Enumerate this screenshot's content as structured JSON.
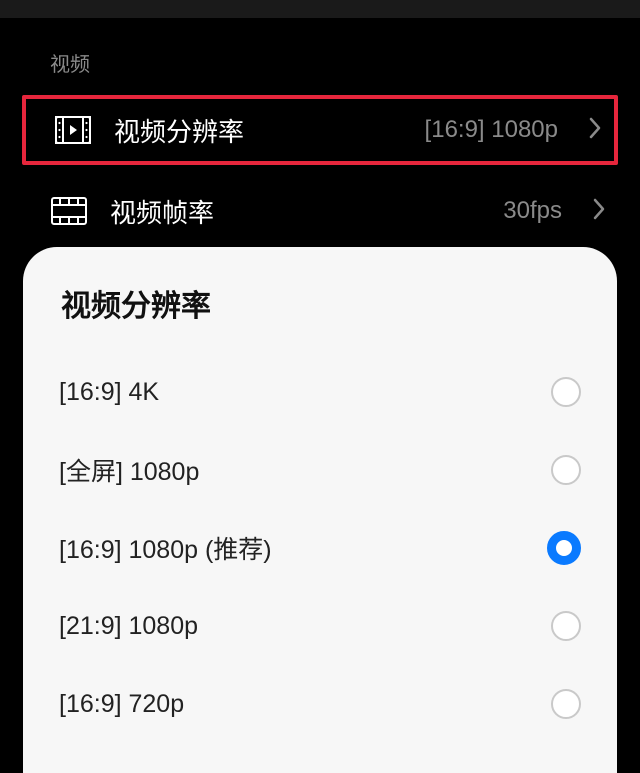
{
  "section_label": "视频",
  "rows": {
    "resolution": {
      "label": "视频分辨率",
      "value": "[16:9] 1080p"
    },
    "fps": {
      "label": "视频帧率",
      "value": "30fps"
    }
  },
  "sheet": {
    "title": "视频分辨率",
    "options": [
      {
        "label": "[16:9] 4K",
        "selected": false
      },
      {
        "label": "[全屏] 1080p",
        "selected": false
      },
      {
        "label": "[16:9] 1080p (推荐)",
        "selected": true
      },
      {
        "label": "[21:9] 1080p",
        "selected": false
      },
      {
        "label": "[16:9] 720p",
        "selected": false
      }
    ]
  }
}
